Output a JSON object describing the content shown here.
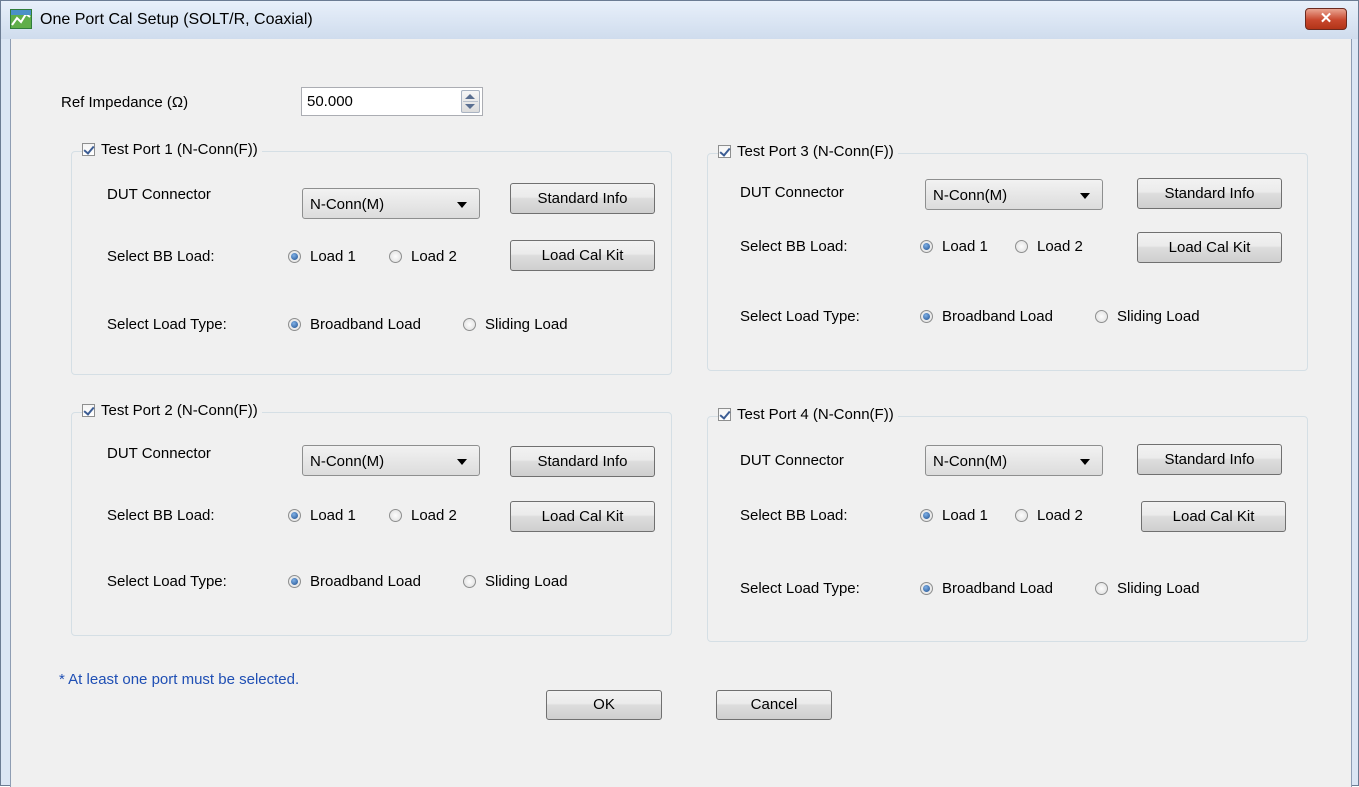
{
  "window": {
    "title": "One Port Cal Setup (SOLT/R, Coaxial)",
    "close_label": "✕"
  },
  "ref_impedance": {
    "label": "Ref Impedance (Ω)",
    "value": "50.000"
  },
  "ports": [
    {
      "title": "Test Port 1 (N-Conn(F))",
      "checked": true,
      "dut_label": "DUT Connector",
      "dut_value": "N-Conn(M)",
      "standard_info": "Standard Info",
      "bb_label": "Select BB Load:",
      "load1": "Load 1",
      "load2": "Load 2",
      "load_cal_kit": "Load Cal Kit",
      "type_label": "Select Load Type:",
      "broadband": "Broadband Load",
      "sliding": "Sliding Load"
    },
    {
      "title": "Test Port 2 (N-Conn(F))",
      "checked": true,
      "dut_label": "DUT Connector",
      "dut_value": "N-Conn(M)",
      "standard_info": "Standard Info",
      "bb_label": "Select BB Load:",
      "load1": "Load 1",
      "load2": "Load 2",
      "load_cal_kit": "Load Cal Kit",
      "type_label": "Select Load Type:",
      "broadband": "Broadband Load",
      "sliding": "Sliding Load"
    },
    {
      "title": "Test Port 3 (N-Conn(F))",
      "checked": true,
      "dut_label": "DUT Connector",
      "dut_value": "N-Conn(M)",
      "standard_info": "Standard Info",
      "bb_label": "Select BB Load:",
      "load1": "Load 1",
      "load2": "Load 2",
      "load_cal_kit": "Load Cal Kit",
      "type_label": "Select Load Type:",
      "broadband": "Broadband Load",
      "sliding": "Sliding Load"
    },
    {
      "title": "Test Port 4 (N-Conn(F))",
      "checked": true,
      "dut_label": "DUT Connector",
      "dut_value": "N-Conn(M)",
      "standard_info": "Standard Info",
      "bb_label": "Select BB Load:",
      "load1": "Load 1",
      "load2": "Load 2",
      "load_cal_kit": "Load Cal Kit",
      "type_label": "Select Load Type:",
      "broadband": "Broadband Load",
      "sliding": "Sliding Load"
    }
  ],
  "note": "* At least one port must be selected.",
  "footer": {
    "ok": "OK",
    "cancel": "Cancel"
  },
  "colors": {
    "note": "#1f4fb4",
    "radio_selected": "#1e4f8f",
    "close_button": "#c8472d"
  }
}
